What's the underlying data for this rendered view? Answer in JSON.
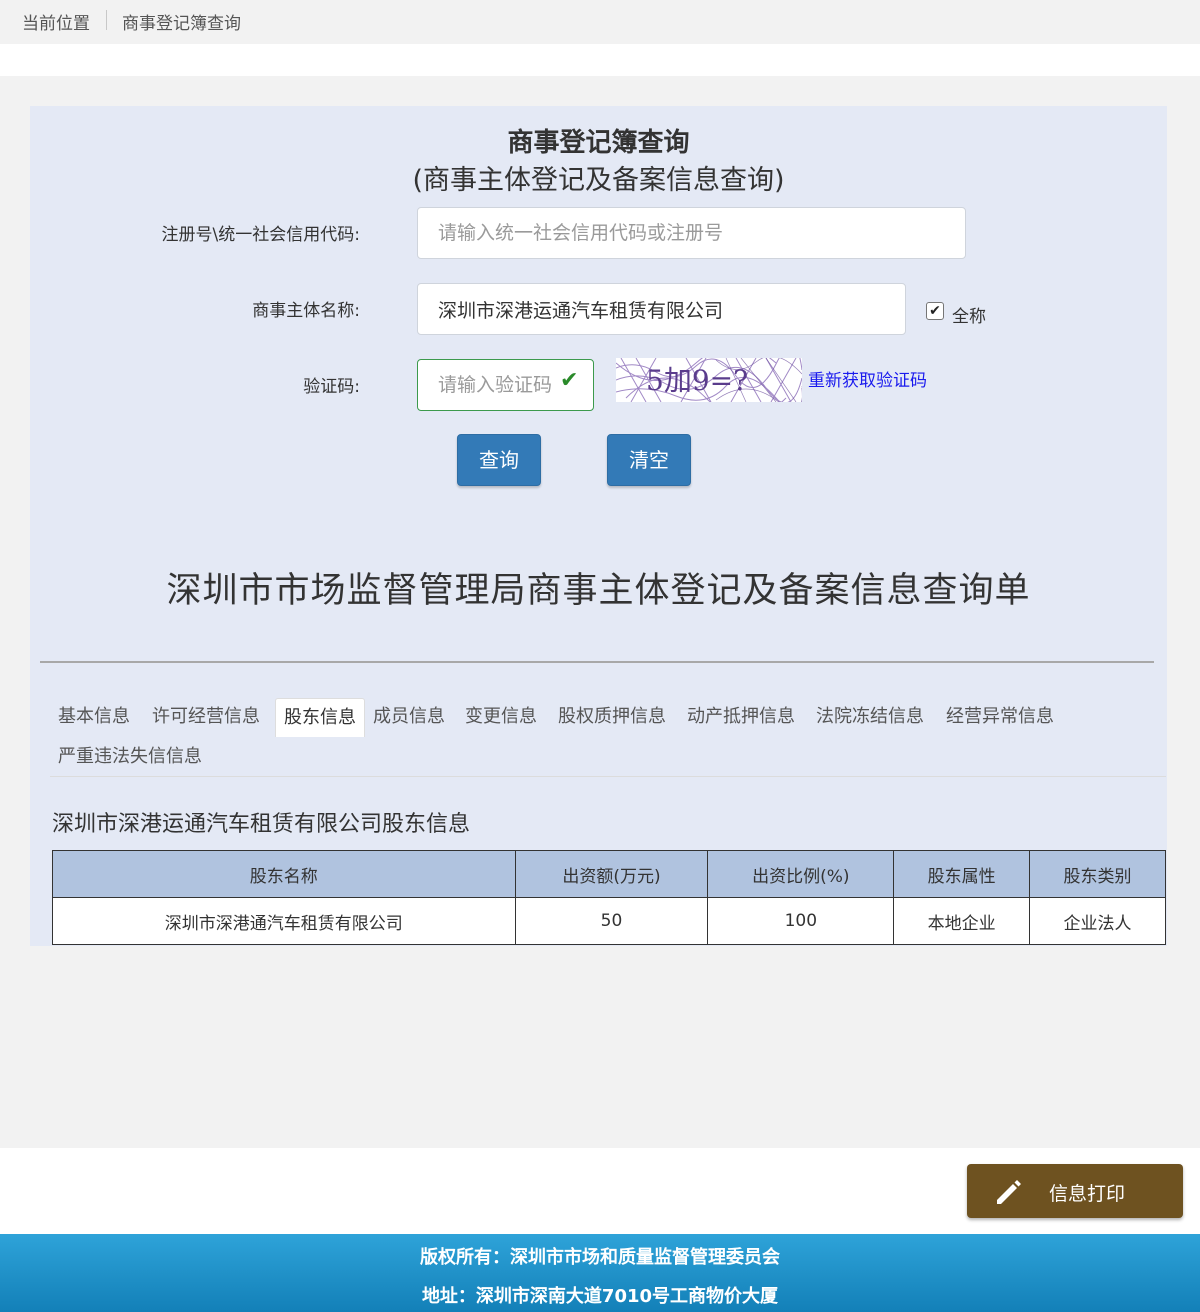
{
  "breadcrumb": {
    "home": "当前位置",
    "current": "商事登记簿查询"
  },
  "form": {
    "title": "商事登记簿查询",
    "subtitle": "(商事主体登记及备案信息查询)",
    "code_label": "注册号\\统一社会信用代码:",
    "code_placeholder": "请输入统一社会信用代码或注册号",
    "code_value": "",
    "name_label": "商事主体名称:",
    "name_value": "深圳市深港运通汽车租赁有限公司",
    "fullname_label": "全称",
    "fullname_checked": true,
    "captcha_label": "验证码:",
    "captcha_placeholder": "请输入验证码",
    "captcha_text": "5加9=?",
    "refresh_label": "重新获取验证码",
    "query_label": "查询",
    "clear_label": "清空"
  },
  "report": {
    "title": "深圳市市场监督管理局商事主体登记及备案信息查询单",
    "tabs": [
      {
        "label": "基本信息"
      },
      {
        "label": "许可经营信息"
      },
      {
        "label": "股东信息"
      },
      {
        "label": "成员信息"
      },
      {
        "label": "变更信息"
      },
      {
        "label": "股权质押信息"
      },
      {
        "label": "动产抵押信息"
      },
      {
        "label": "法院冻结信息"
      },
      {
        "label": "经营异常信息"
      },
      {
        "label": "严重违法失信信息"
      }
    ],
    "active_tab": "股东信息",
    "section_title": "深圳市深港运通汽车租赁有限公司股东信息",
    "table": {
      "headers": [
        "股东名称",
        "出资额(万元)",
        "出资比例(%)",
        "股东属性",
        "股东类别"
      ],
      "rows": [
        [
          "深圳市深港通汽车租赁有限公司",
          "50",
          "100",
          "本地企业",
          "企业法人"
        ]
      ]
    }
  },
  "print_button": {
    "label": "信息打印",
    "icon": "pencil-icon"
  },
  "footer": {
    "copyright": "版权所有：深圳市市场和质量监督管理委员会",
    "address": "地址：深圳市深南大道7010号工商物价大厦"
  },
  "colors": {
    "panel_bg": "#e4e9f5",
    "primary_button": "#337ab7",
    "print_button": "#6e5220",
    "table_header": "#b0c3df",
    "footer": "#1a8fc8",
    "link": "#1a1aee"
  }
}
